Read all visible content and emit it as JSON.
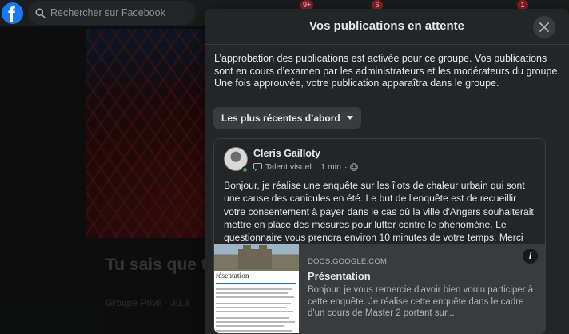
{
  "topbar": {
    "search_placeholder": "Rechercher sur Facebook",
    "badges": [
      "9+",
      "6",
      "1"
    ]
  },
  "background": {
    "group_title": "Tu sais que t... quand..",
    "group_meta": "Groupe Privé · 30,3"
  },
  "dialog": {
    "title": "Vos publications en attente",
    "info_text": "L’approbation des publications est activée pour ce groupe. Vos publications sont en cours d’examen par les administrateurs et les modérateurs du groupe. Une fois approuvée, votre publication apparaîtra dans le groupe.",
    "sort_label": "Les plus récentes d’abord"
  },
  "post": {
    "author": "Cleris Gailloty",
    "badge": "Talent visuel",
    "time": "1 min",
    "text": "Bonjour, je réalise une enquête sur les îlots de chaleur urbain qui sont une cause des canicules en été. Le but de l'enquête est de recueillir votre consentement à payer dans le cas où la ville d'Angers souhaiterait mettre en place des mesures pour lutter contre le phénomène. Le questionnaire vous prendra environ 10 minutes de votre temps.  Merci",
    "link": {
      "domain": "DOCS.GOOGLE.COM",
      "title": "Présentation",
      "description": "Bonjour, je vous remercie d'avoir bien voulu participer à cette enquête. Je réalise cette enquête dans le cadre d'un cours de Master 2 portant sur...",
      "thumb_title": "résentation"
    }
  },
  "colors": {
    "brand": "#1877f2",
    "online": "#31a24c",
    "dialog_bg": "#242526"
  }
}
